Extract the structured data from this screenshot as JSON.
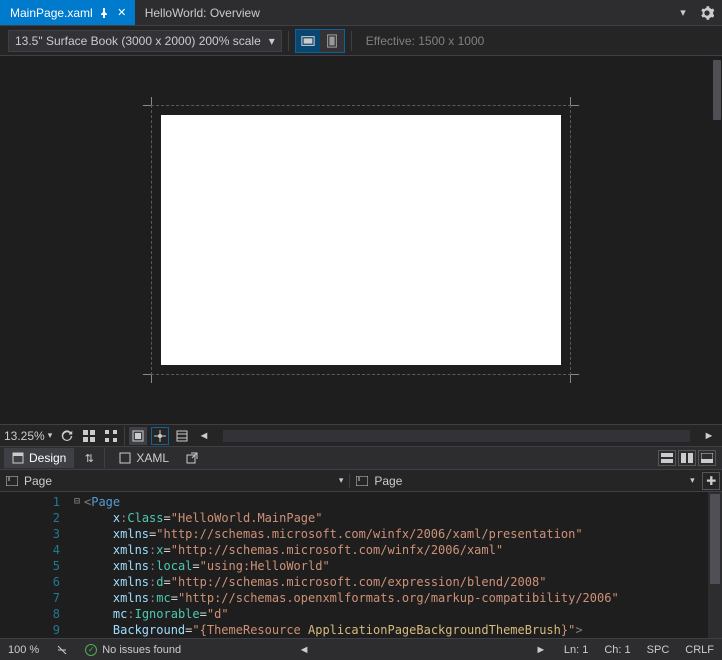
{
  "tabs": {
    "active": {
      "label": "MainPage.xaml"
    },
    "other": {
      "label": "HelloWorld: Overview"
    }
  },
  "toolbar": {
    "device_label": "13.5\" Surface Book (3000 x 2000) 200% scale",
    "effective_label": "Effective: 1500 x 1000"
  },
  "zoombar": {
    "zoom_value": "13.25%"
  },
  "dxbar": {
    "design_label": "Design",
    "xaml_label": "XAML"
  },
  "elembar": {
    "left_label": "Page",
    "right_label": "Page"
  },
  "editor": {
    "lines": [
      "1",
      "2",
      "3",
      "4",
      "5",
      "6",
      "7",
      "8",
      "9"
    ],
    "l1_tag": "Page",
    "l2_attr": "x",
    "l2_ns": "Class",
    "l2_val": "HelloWorld.MainPage",
    "l3_attr": "xmlns",
    "l3_val": "http://schemas.microsoft.com/winfx/2006/xaml/presentation",
    "l4_attr": "xmlns",
    "l4_ns": "x",
    "l4_val": "http://schemas.microsoft.com/winfx/2006/xaml",
    "l5_attr": "xmlns",
    "l5_ns": "local",
    "l5_val": "using:HelloWorld",
    "l6_attr": "xmlns",
    "l6_ns": "d",
    "l6_val": "http://schemas.microsoft.com/expression/blend/2008",
    "l7_attr": "xmlns",
    "l7_ns": "mc",
    "l7_val": "http://schemas.openxmlformats.org/markup-compatibility/2006",
    "l8_attr": "mc",
    "l8_ns": "Ignorable",
    "l8_val": "d",
    "l9_attr": "Background",
    "l9_pre": "{ThemeResource ",
    "l9_res": "ApplicationPageBackgroundThemeBrush",
    "l9_post": "}"
  },
  "status": {
    "zoom": "100 %",
    "issues": "No issues found",
    "line": "Ln: 1",
    "col": "Ch: 1",
    "indent": "SPC",
    "eol": "CRLF"
  }
}
